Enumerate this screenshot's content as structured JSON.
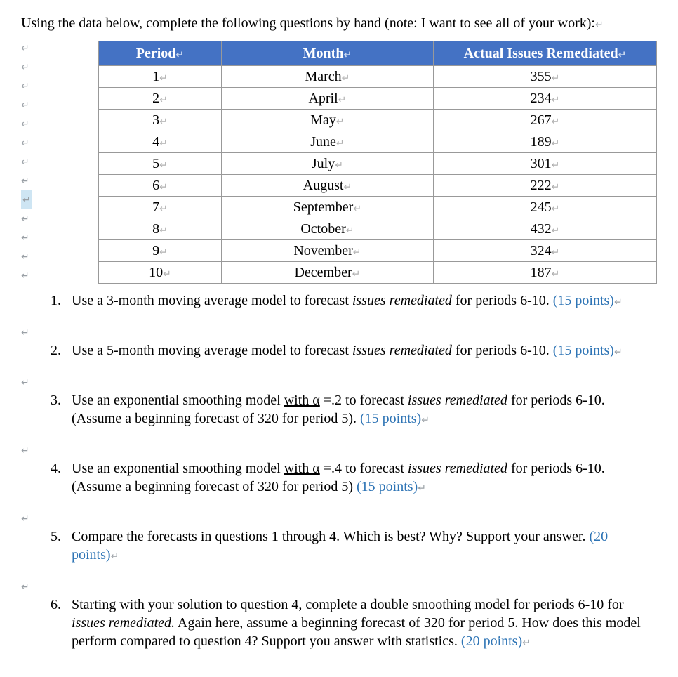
{
  "intro": "Using the data below, complete the following questions by hand (note: I want to see all of your work):",
  "table": {
    "headers": [
      "Period",
      "Month",
      "Actual Issues Remediated"
    ],
    "rows": [
      [
        "1",
        "March",
        "355"
      ],
      [
        "2",
        "April",
        "234"
      ],
      [
        "3",
        "May",
        "267"
      ],
      [
        "4",
        "June",
        "189"
      ],
      [
        "5",
        "July",
        "301"
      ],
      [
        "6",
        "August",
        "222"
      ],
      [
        "7",
        "September",
        "245"
      ],
      [
        "8",
        "October",
        "432"
      ],
      [
        "9",
        "November",
        "324"
      ],
      [
        "10",
        "December",
        "187"
      ]
    ]
  },
  "questions": {
    "q1": {
      "text_a": "Use a 3-month moving average model to forecast ",
      "italic": "issues remediated",
      "text_b": " for periods 6-10. ",
      "points": "(15 points)"
    },
    "q2": {
      "text_a": "Use a 5-month moving average model to forecast ",
      "italic": "issues remediated",
      "text_b": " for periods 6-10. ",
      "points": "(15 points)"
    },
    "q3": {
      "text_a": "Use an exponential smoothing model ",
      "underline": "with  α",
      "text_b": " =.2 to forecast ",
      "italic": "issues remediated",
      "text_c": " for periods 6-10.  (Assume a beginning forecast of 320 for period 5). ",
      "points": "(15 points)"
    },
    "q4": {
      "text_a": "Use an exponential smoothing model ",
      "underline": "with  α",
      "text_b": " =.4 to forecast ",
      "italic": "issues remediated",
      "text_c": " for periods 6-10.  (Assume a beginning forecast of 320 for period 5) ",
      "points": "(15 points)"
    },
    "q5": {
      "text_a": "Compare the forecasts in questions 1 through 4.  Which is best?  Why?  Support your answer. ",
      "points": "(20 points)"
    },
    "q6": {
      "text_a": "Starting with your solution to question 4, complete a double smoothing model for periods 6-10 for ",
      "italic": "issues remediated.",
      "text_b": "  Again here, assume a beginning forecast of 320 for period 5.  How does this model perform compared to question 4?  Support you answer with statistics. ",
      "points": "(20 points)"
    }
  },
  "mark": "↵"
}
